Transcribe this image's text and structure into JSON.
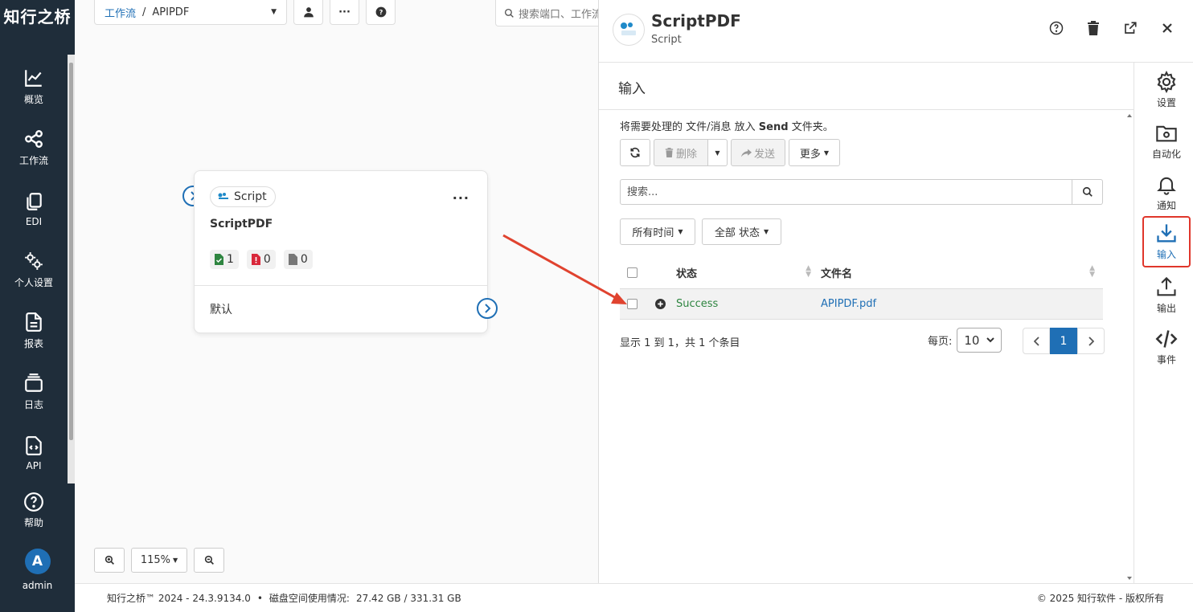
{
  "brand": "知行之桥",
  "sidebar": {
    "items": [
      {
        "label": "概览",
        "icon": "chart-line-icon"
      },
      {
        "label": "工作流",
        "icon": "workflow-icon"
      },
      {
        "label": "EDI",
        "icon": "copy-icon"
      },
      {
        "label": "个人设置",
        "icon": "gears-icon"
      },
      {
        "label": "报表",
        "icon": "file-text-icon"
      },
      {
        "label": "日志",
        "icon": "layers-icon"
      },
      {
        "label": "API",
        "icon": "file-code-icon"
      }
    ],
    "help": "帮助",
    "user_initial": "A",
    "user_name": "admin"
  },
  "canvas": {
    "breadcrumb": {
      "root": "工作流",
      "sep": "/",
      "current": "APIPDF"
    },
    "search_placeholder": "搜索端口、工作流",
    "zoom_level": "115%",
    "node": {
      "tag": "Script",
      "title": "ScriptPDF",
      "counts": {
        "success": "1",
        "error": "0",
        "pending": "0"
      },
      "default_label": "默认"
    }
  },
  "panel": {
    "title": "ScriptPDF",
    "subtitle": "Script",
    "section": "输入",
    "hint_pre": "将需要处理的 文件/消息 放入",
    "hint_bold": "Send",
    "hint_post": "文件夹。",
    "toolbar": {
      "delete": "删除",
      "send": "发送",
      "more": "更多"
    },
    "search_placeholder": "搜索...",
    "filters": {
      "time": "所有时间",
      "status": "全部 状态"
    },
    "table": {
      "headers": {
        "status": "状态",
        "filename": "文件名"
      },
      "rows": [
        {
          "status": "Success",
          "filename": "APIPDF.pdf"
        }
      ]
    },
    "info": "显示 1 到 1，共 1 个条目",
    "per_page_label": "每页:",
    "per_page_value": "10",
    "current_page": "1",
    "right_nav": [
      {
        "label": "设置",
        "icon": "gear-icon"
      },
      {
        "label": "自动化",
        "icon": "folder-gear-icon"
      },
      {
        "label": "通知",
        "icon": "bell-icon"
      },
      {
        "label": "输入",
        "icon": "download-icon"
      },
      {
        "label": "输出",
        "icon": "upload-icon"
      },
      {
        "label": "事件",
        "icon": "code-icon"
      }
    ]
  },
  "footer": {
    "version": "知行之桥™ 2024 - 24.3.9134.0",
    "disk_label": "磁盘空间使用情况:",
    "disk_value": "27.42 GB / 331.31 GB",
    "copyright": "© 2025 知行软件 - 版权所有"
  },
  "colors": {
    "sidebar_bg": "#1f2d3a",
    "accent": "#1f6fb5",
    "success": "#2e8540",
    "highlight": "#e0362b"
  }
}
